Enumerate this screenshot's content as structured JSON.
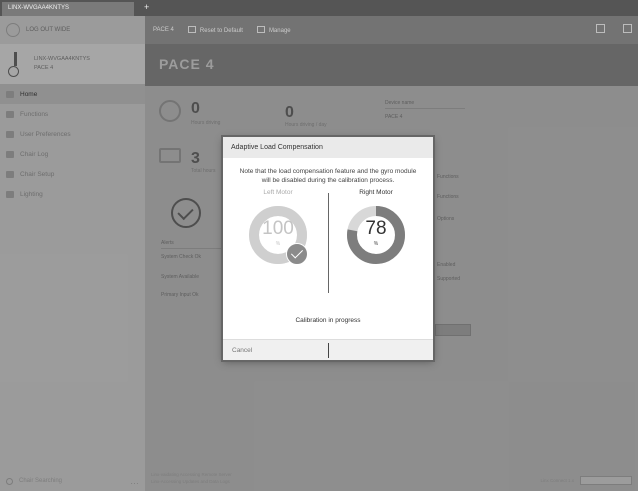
{
  "window": {
    "tab_label": "LINX-WVGAA4KNTYS"
  },
  "sidebar": {
    "search_label": "LOG OUT WIDE",
    "device_name": "LINX-WVGAA4KNTYS",
    "device_sub": "PACE 4",
    "items": [
      {
        "label": "Home",
        "icon": "home-icon",
        "active": true
      },
      {
        "label": "Functions",
        "icon": "functions-icon"
      },
      {
        "label": "User Preferences",
        "icon": "user-icon"
      },
      {
        "label": "Chair Log",
        "icon": "log-icon"
      },
      {
        "label": "Chair Setup",
        "icon": "setup-icon"
      },
      {
        "label": "Lighting",
        "icon": "lighting-icon"
      }
    ],
    "bottom_label": "Chair Searching"
  },
  "toolbar": {
    "device": "PACE 4",
    "reset": "Reset to Default",
    "manage": "Manage"
  },
  "page": {
    "title": "PACE 4"
  },
  "background": {
    "stat_a_value": "0",
    "stat_a_label": "Hours driving",
    "stat_b_value": "0",
    "stat_b_label": "Hours driving / day",
    "stat_c_value": "3",
    "stat_c_label": "Total hours",
    "device_name_label": "Device name",
    "device_name_value": "PACE 4",
    "alerts_label": "Alerts",
    "row_1": "System Check Ok",
    "row_2": "System Available",
    "row_3": "Primary Input Ok",
    "right_1": "Functions",
    "right_2": "Functions",
    "right_3": "Options",
    "right_4": "Enabled",
    "right_5": "Supported",
    "footer_line_1": "Linx-vaidating Accessing Remote Server",
    "footer_line_2": "Linx-Accessing Updates and Data Logs",
    "footer_version": "Linx Connect 1.x"
  },
  "dialog": {
    "title": "Adaptive Load Compensation",
    "description": "Note that the load compensation feature and the gyro module will be disabled during the calibration process.",
    "left_motor": {
      "label": "Left Motor",
      "value": "100",
      "unit": "%",
      "progress": 1.0,
      "complete": true
    },
    "right_motor": {
      "label": "Right Motor",
      "value": "78",
      "unit": "%",
      "progress": 0.78,
      "complete": false
    },
    "status": "Calibration in progress",
    "cancel_label": "Cancel"
  }
}
